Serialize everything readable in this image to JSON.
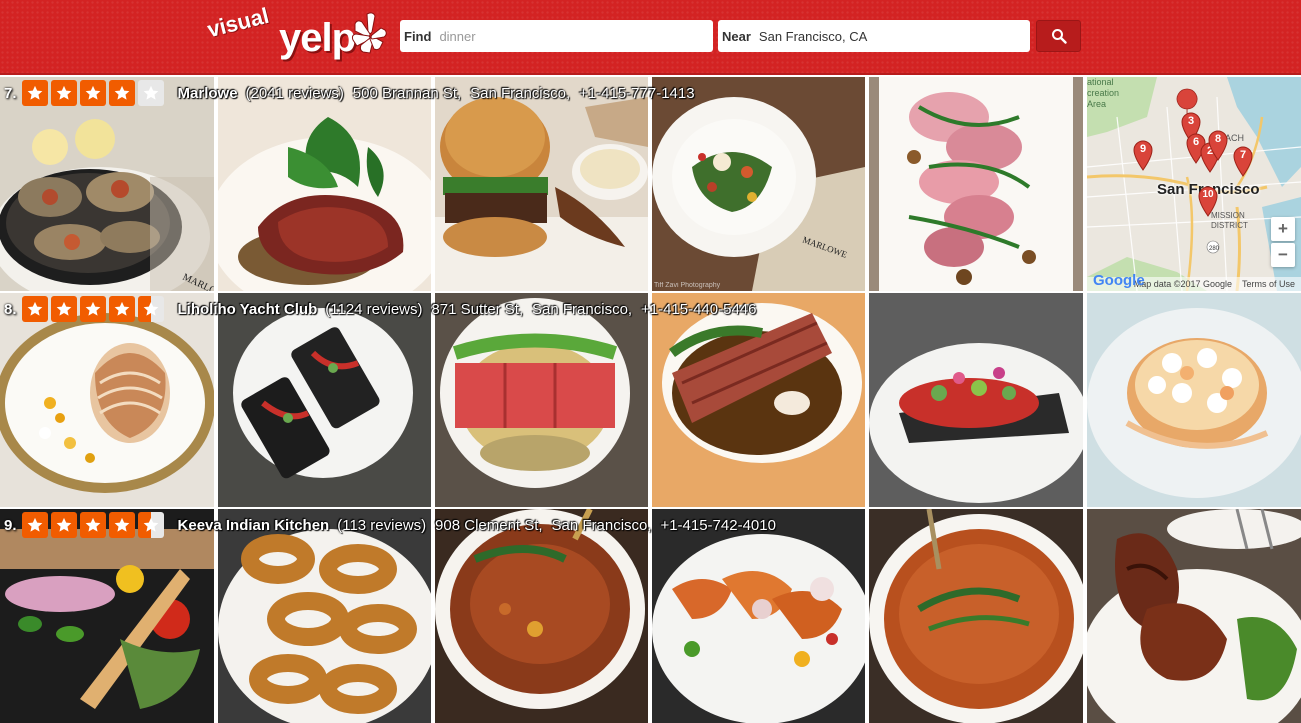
{
  "app": {
    "logo_small": "visual",
    "logo_main": "yelp",
    "brand_color": "#d32323",
    "star_color": "#f15c00"
  },
  "search": {
    "find_label": "Find",
    "find_value": "",
    "find_placeholder": "dinner",
    "near_label": "Near",
    "near_value": "San Francisco, CA",
    "near_placeholder": "",
    "button_icon": "search-icon"
  },
  "results": [
    {
      "rank": "7.",
      "rating": 4,
      "name": "Marlowe",
      "reviews": "(2041 reviews)",
      "address": "500 Brannan St,",
      "city": "San Francisco,",
      "phone": "+1-415-777-1413"
    },
    {
      "rank": "8.",
      "rating": 4.5,
      "name": "Liholiho Yacht Club",
      "reviews": "(1124 reviews)",
      "address": "871 Sutter St,",
      "city": "San Francisco,",
      "phone": "+1-415-440-5446"
    },
    {
      "rank": "9.",
      "rating": 4.5,
      "name": "Keeva Indian Kitchen",
      "reviews": "(113 reviews)",
      "address": "908 Clement St,",
      "city": "San Francisco,",
      "phone": "+1-415-742-4010"
    }
  ],
  "photos": {
    "watermark_1": "MARLOWE",
    "watermark_2": "MARLOWE",
    "credit": "Tiff Zavi Photography"
  },
  "map": {
    "city_label": "San Francisco",
    "area_label_1": "ational",
    "area_label_2": "creation",
    "area_label_3": "Area",
    "beach_label": "BEACH",
    "mission_label_1": "MISSION",
    "mission_label_2": "DISTRICT",
    "highway": "280",
    "zoom_in": "+",
    "zoom_out": "−",
    "google": "Google",
    "data_credit": "Map data ©2017 Google",
    "terms": "Terms of Use",
    "markers": [
      "3",
      "9",
      "6",
      "2",
      "8",
      "7",
      "10"
    ]
  }
}
